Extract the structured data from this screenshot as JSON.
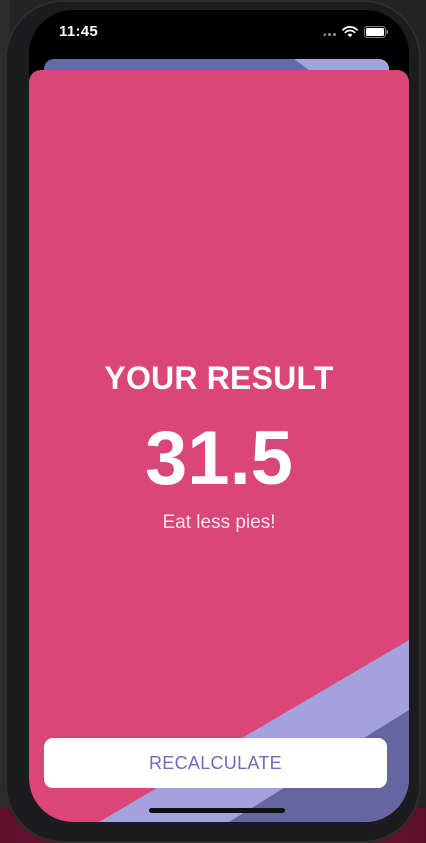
{
  "status_bar": {
    "time": "11:45",
    "icons": [
      "cellular-dots-icon",
      "wifi-icon",
      "battery-icon"
    ]
  },
  "result": {
    "title": "YOUR RESULT",
    "value": "31.5",
    "advice": "Eat less pies!"
  },
  "actions": {
    "recalculate_label": "RECALCULATE"
  },
  "colors": {
    "sheet_background": "#db4678",
    "stripe_light": "#a4a2dc",
    "stripe_dark": "#65669f",
    "button_text": "#6d6bc2",
    "button_background": "#ffffff"
  }
}
